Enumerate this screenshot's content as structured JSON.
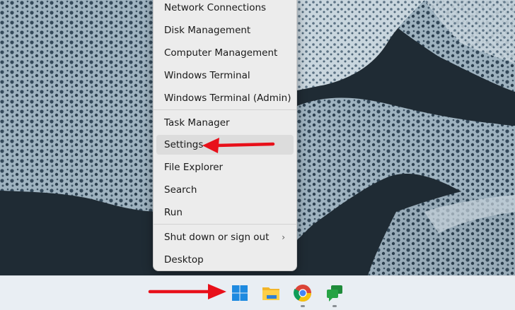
{
  "start_menu": {
    "items": [
      {
        "label": "Network Connections"
      },
      {
        "label": "Disk Management"
      },
      {
        "label": "Computer Management"
      },
      {
        "label": "Windows Terminal"
      },
      {
        "label": "Windows Terminal (Admin)"
      },
      {
        "label": "Task Manager"
      },
      {
        "label": "Settings"
      },
      {
        "label": "File Explorer"
      },
      {
        "label": "Search"
      },
      {
        "label": "Run"
      },
      {
        "label": "Shut down or sign out"
      },
      {
        "label": "Desktop"
      }
    ],
    "highlighted": "Settings"
  },
  "taskbar": {
    "icons": [
      "windows-start-icon",
      "file-explorer-icon",
      "chrome-icon",
      "chat-icon"
    ]
  },
  "colors": {
    "arrow": "#e8101a",
    "menu_bg": "#ececec",
    "taskbar_bg": "#e9eef3",
    "windows_blue": "#1e8ae0"
  }
}
